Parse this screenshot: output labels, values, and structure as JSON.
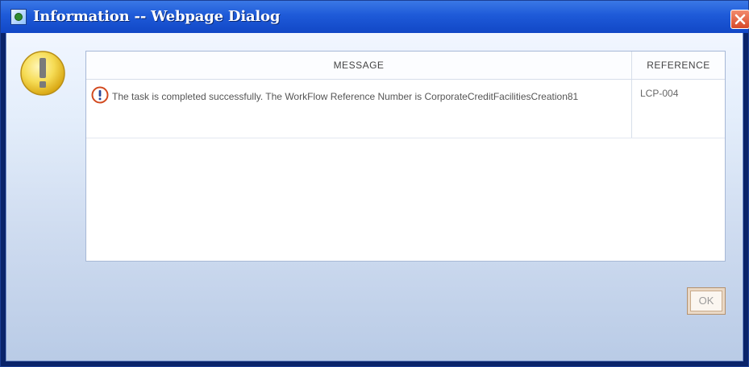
{
  "window": {
    "title": "Information -- Webpage Dialog",
    "icon": "ie-window-icon",
    "close_icon": "close-icon"
  },
  "dialog": {
    "severity_icon": "warning-exclamation-icon",
    "table": {
      "headers": {
        "message": "MESSAGE",
        "reference": "REFERENCE"
      },
      "rows": [
        {
          "icon": "info-exclamation-icon",
          "message": "The task is completed successfully. The WorkFlow Reference Number is CorporateCreditFacilitiesCreation81",
          "reference": "LCP-004"
        }
      ]
    },
    "ok_label": "OK"
  },
  "colors": {
    "titlebar": "#1e5ad8",
    "warning_fill": "#f3d24a",
    "close_button": "#d74a2a",
    "info_icon": "#d24a1f"
  }
}
